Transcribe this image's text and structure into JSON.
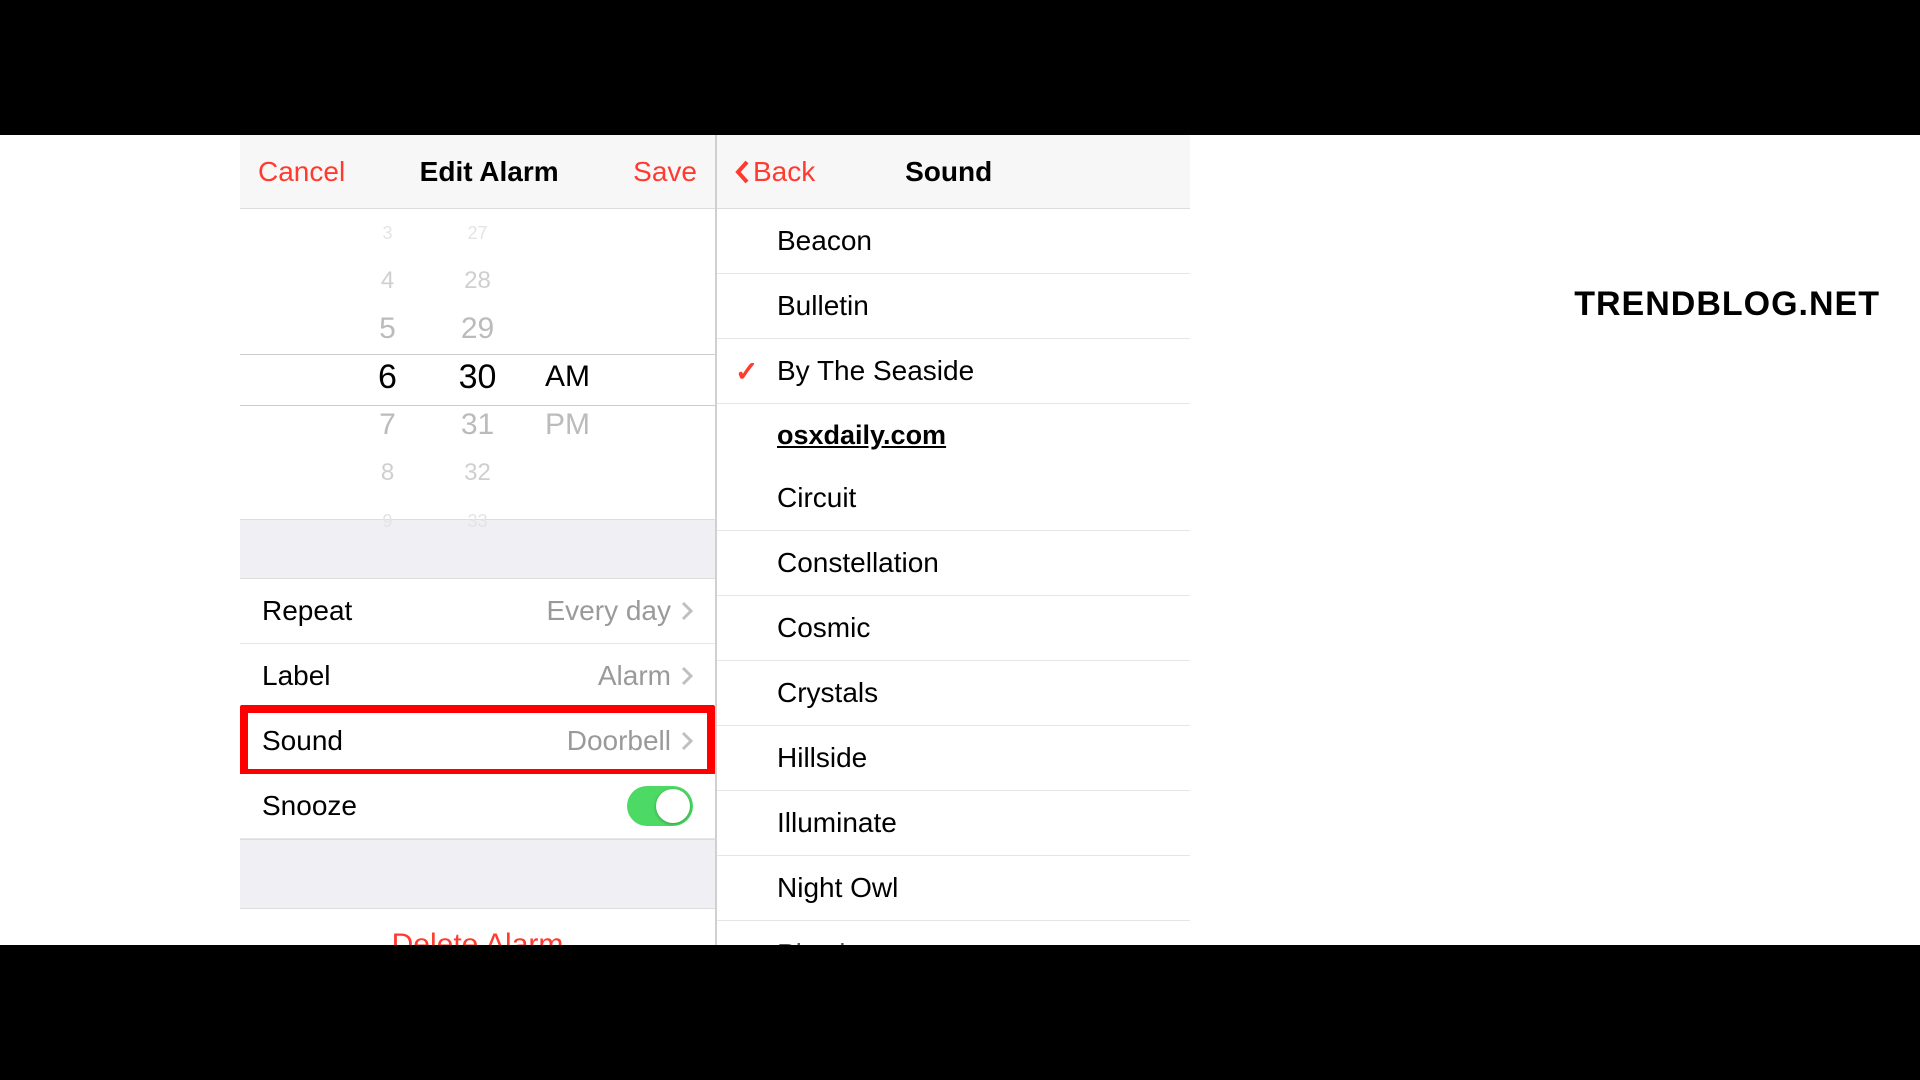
{
  "watermark": "TRENDBLOG.NET",
  "left_screen": {
    "nav": {
      "cancel": "Cancel",
      "title": "Edit Alarm",
      "save": "Save"
    },
    "picker": {
      "hours": [
        "3",
        "4",
        "5",
        "6",
        "7",
        "8",
        "9"
      ],
      "minutes": [
        "27",
        "28",
        "29",
        "30",
        "31",
        "32",
        "33"
      ],
      "ampm": [
        "AM",
        "PM"
      ],
      "selected_hour": "6",
      "selected_minute": "30",
      "selected_ampm": "AM"
    },
    "settings": {
      "repeat": {
        "label": "Repeat",
        "value": "Every day"
      },
      "label": {
        "label": "Label",
        "value": "Alarm"
      },
      "sound": {
        "label": "Sound",
        "value": "Doorbell"
      },
      "snooze": {
        "label": "Snooze",
        "on": true
      }
    },
    "delete": "Delete Alarm"
  },
  "right_screen": {
    "nav": {
      "back": "Back",
      "title": "Sound"
    },
    "inline_watermark": "osxdaily.com",
    "sounds": [
      {
        "name": "Beacon",
        "selected": false
      },
      {
        "name": "Bulletin",
        "selected": false
      },
      {
        "name": "By The Seaside",
        "selected": true
      },
      {
        "name": "Circuit",
        "selected": false
      },
      {
        "name": "Constellation",
        "selected": false
      },
      {
        "name": "Cosmic",
        "selected": false
      },
      {
        "name": "Crystals",
        "selected": false
      },
      {
        "name": "Hillside",
        "selected": false
      },
      {
        "name": "Illuminate",
        "selected": false
      },
      {
        "name": "Night Owl",
        "selected": false
      },
      {
        "name": "Playtime",
        "selected": false
      }
    ]
  }
}
